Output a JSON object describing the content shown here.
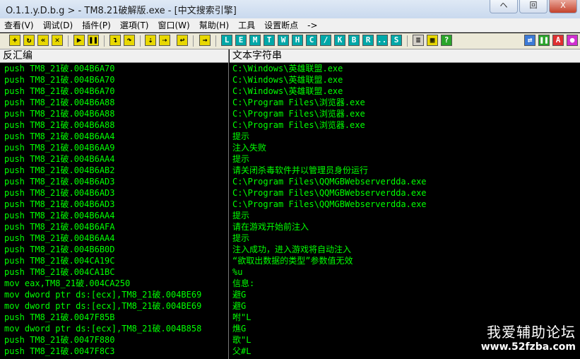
{
  "window": {
    "title": "O.1.1.y.D.b.g > - TM8.21破解版.exe - [中文搜索引擎]",
    "controls": [
      "ヘ",
      "回",
      "X"
    ]
  },
  "menu": [
    "查看(V)",
    "调试(D)",
    "插件(P)",
    "選項(T)",
    "窗口(W)",
    "幫助(H)",
    "工具",
    "设置断点",
    "->"
  ],
  "toolbar": {
    "letters": [
      "L",
      "E",
      "M",
      "T",
      "W",
      "H",
      "C",
      "/",
      "K",
      "B",
      "R",
      "...",
      "S"
    ]
  },
  "columns": {
    "disassembly": "反汇编",
    "strings": "文本字符串"
  },
  "rows": [
    {
      "dis": "push TM8_21破.004B6A70",
      "str": "C:\\Windows\\英雄联盟.exe"
    },
    {
      "dis": "push TM8_21破.004B6A70",
      "str": "C:\\Windows\\英雄联盟.exe"
    },
    {
      "dis": "push TM8_21破.004B6A70",
      "str": "C:\\Windows\\英雄联盟.exe"
    },
    {
      "dis": "push TM8_21破.004B6A88",
      "str": "C:\\Program Files\\浏览器.exe"
    },
    {
      "dis": "push TM8_21破.004B6A88",
      "str": "C:\\Program Files\\浏览器.exe"
    },
    {
      "dis": "push TM8_21破.004B6A88",
      "str": "C:\\Program Files\\浏览器.exe"
    },
    {
      "dis": "push TM8_21破.004B6AA4",
      "str": "提示"
    },
    {
      "dis": "push TM8_21破.004B6AA9",
      "str": "注入失败"
    },
    {
      "dis": "push TM8_21破.004B6AA4",
      "str": "提示"
    },
    {
      "dis": "push TM8_21破.004B6AB2",
      "str": "请关闭杀毒软件并以管理员身份运行"
    },
    {
      "dis": "push TM8_21破.004B6AD3",
      "str": "C:\\Program Files\\QQMGBWebserverdda.exe"
    },
    {
      "dis": "push TM8_21破.004B6AD3",
      "str": "C:\\Program Files\\QQMGBWebserverdda.exe"
    },
    {
      "dis": "push TM8_21破.004B6AD3",
      "str": "C:\\Program Files\\QQMGBWebserverdda.exe"
    },
    {
      "dis": "push TM8_21破.004B6AA4",
      "str": "提示"
    },
    {
      "dis": "push TM8_21破.004B6AFA",
      "str": "请在游戏开始前注入"
    },
    {
      "dis": "push TM8_21破.004B6AA4",
      "str": "提示"
    },
    {
      "dis": "push TM8_21破.004B6B0D",
      "str": "注入成功，进入游戏将自动注入"
    },
    {
      "dis": "push TM8_21破.004CA19C",
      "str": "“欲取出数据的类型”参数值无效"
    },
    {
      "dis": "push TM8_21破.004CA1BC",
      "str": "%u"
    },
    {
      "dis": "mov eax,TM8_21破.004CA250",
      "str": "信息:"
    },
    {
      "dis": "mov dword ptr ds:[ecx],TM8_21破.004BE69",
      "str": "避G"
    },
    {
      "dis": "mov dword ptr ds:[ecx],TM8_21破.004BE69",
      "str": "避G"
    },
    {
      "dis": "push TM8_21破.0047F85B",
      "str": "咐\"L"
    },
    {
      "dis": "mov dword ptr ds:[ecx],TM8_21破.004B858",
      "str": "燋G"
    },
    {
      "dis": "push TM8_21破.0047F880",
      "str": "歌\"L"
    },
    {
      "dis": "push TM8_21破.0047F8C3",
      "str": "父#L"
    }
  ],
  "watermark": {
    "line1": "我爱辅助论坛",
    "line2": "www.52fzba.com"
  }
}
